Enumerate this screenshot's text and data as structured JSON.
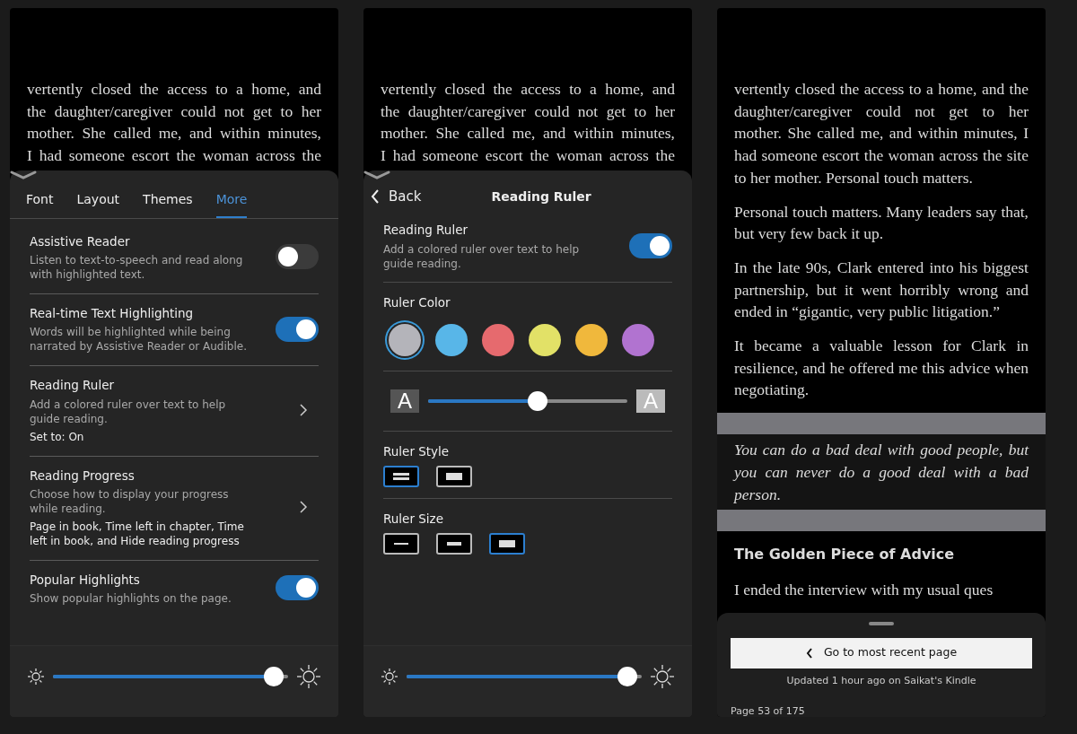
{
  "panels": [
    {
      "kind": "settings",
      "page_lines": [
        "vertently closed the access to a home, and",
        "the daughter/caregiver could not get to her",
        "mother. She called me, and within minutes,",
        "I had someone escort the woman across the"
      ],
      "tabs": [
        {
          "label": "Font",
          "selected": false
        },
        {
          "label": "Layout",
          "selected": false
        },
        {
          "label": "Themes",
          "selected": false
        },
        {
          "label": "More",
          "selected": true
        }
      ],
      "settings": [
        {
          "kind": "toggle",
          "title": "Assistive Reader",
          "description": "Listen to text-to-speech and read along with highlighted text.",
          "on": false
        },
        {
          "kind": "toggle",
          "title": "Real-time Text Highlighting",
          "description": "Words will be highlighted while being narrated by Assistive Reader or Audible.",
          "on": true
        },
        {
          "kind": "link",
          "title": "Reading Ruler",
          "description": "Add a colored ruler over text to help guide reading.",
          "value": "Set to: On"
        },
        {
          "kind": "link",
          "title": "Reading Progress",
          "description": "Choose how to display your progress while reading.",
          "value": "Page in book, Time left in chapter, Time left in book, and Hide reading progress"
        },
        {
          "kind": "toggle",
          "title": "Popular Highlights",
          "description": "Show popular highlights on the page.",
          "on": true
        }
      ],
      "brightness": {
        "level": 0.94
      }
    },
    {
      "kind": "ruler",
      "page_lines": [
        "vertently closed the access to a home, and",
        "the daughter/caregiver could not get to her",
        "mother. She called me, and within minutes,",
        "I had someone escort the woman across the"
      ],
      "back": "Back",
      "title": "Reading Ruler",
      "toggle": {
        "title": "Reading Ruler",
        "description": "Add a colored ruler over text to help guide reading.",
        "on": true
      },
      "color_section": {
        "title": "Ruler Color",
        "colors": [
          {
            "color": "#b4b4ba",
            "selected": true
          },
          {
            "color": "#58b6e8",
            "selected": false
          },
          {
            "color": "#e66a6e",
            "selected": false
          },
          {
            "color": "#e2e167",
            "selected": false
          },
          {
            "color": "#f0b83c",
            "selected": false
          },
          {
            "color": "#b173d0",
            "selected": false
          }
        ]
      },
      "opacity_slider": {
        "min_label": "A",
        "max_label": "A",
        "level": 0.55
      },
      "style_section": {
        "title": "Ruler Style",
        "options": [
          {
            "kind": "lines",
            "selected": true
          },
          {
            "kind": "solid",
            "selected": false
          }
        ]
      },
      "size_section": {
        "title": "Ruler Size",
        "options": [
          {
            "kind": "thin",
            "selected": false
          },
          {
            "kind": "medium",
            "selected": false
          },
          {
            "kind": "thick",
            "selected": true
          }
        ]
      },
      "brightness": {
        "level": 0.94
      }
    },
    {
      "kind": "reader",
      "paragraphs": [
        {
          "kind": "body",
          "text": "vertently closed the access to a home, and the daughter/caregiver could not get to her mother. She called me, and within minutes, I had someone escort the woman across the site to her mother. Personal touch matters."
        },
        {
          "kind": "body",
          "text": "Personal touch matters. Many leaders say that, but very few back it up."
        },
        {
          "kind": "body",
          "text": "In the late 90s, Clark entered into his biggest partnership, but it went horribly wrong and ended in “gigantic, very public litigation.”"
        },
        {
          "kind": "body",
          "text": "It became a valuable lesson for Clark in resilience, and he offered me this advice when negotiating."
        },
        {
          "kind": "quote",
          "text": "You can do a bad deal with good people, but you can never do a good deal with a bad person."
        },
        {
          "kind": "heading",
          "text": "The Golden Piece of Advice"
        },
        {
          "kind": "body",
          "text": "I ended the interview with my usual ques"
        }
      ],
      "sheet": {
        "button": "Go to most recent page",
        "updated": "Updated 1 hour ago on Saikat's Kindle",
        "page": "Page 53 of 175"
      }
    }
  ]
}
